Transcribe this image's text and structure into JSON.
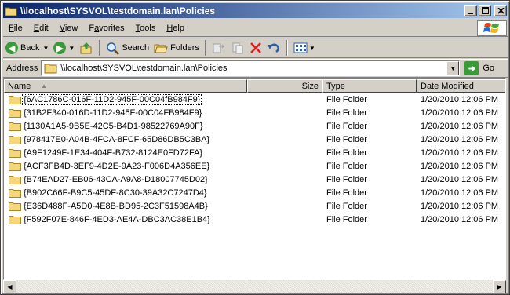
{
  "window": {
    "title": "\\\\localhost\\SYSVOL\\testdomain.lan\\Policies"
  },
  "menu": [
    {
      "label": "File",
      "ul": "F",
      "rest": "ile"
    },
    {
      "label": "Edit",
      "ul": "E",
      "rest": "dit"
    },
    {
      "label": "View",
      "ul": "V",
      "rest": "iew"
    },
    {
      "label": "Favorites",
      "ul": "F",
      "rest": "avorites",
      "pre": "F"
    },
    {
      "label": "Tools",
      "ul": "T",
      "rest": "ools"
    },
    {
      "label": "Help",
      "ul": "H",
      "rest": "elp"
    }
  ],
  "toolbar": {
    "back_label": "Back",
    "search_label": "Search",
    "folders_label": "Folders"
  },
  "address": {
    "label": "Address",
    "value": "\\\\localhost\\SYSVOL\\testdomain.lan\\Policies",
    "go_label": "Go"
  },
  "columns": {
    "name": "Name",
    "size": "Size",
    "type": "Type",
    "modified": "Date Modified"
  },
  "files": [
    {
      "name": "{6AC1786C-016F-11D2-945F-00C04fB984F9}",
      "size": "",
      "type": "File Folder",
      "modified": "1/20/2010 12:06 PM"
    },
    {
      "name": "{31B2F340-016D-11D2-945F-00C04FB984F9}",
      "size": "",
      "type": "File Folder",
      "modified": "1/20/2010 12:06 PM"
    },
    {
      "name": "{1130A1A5-9B5E-42C5-B4D1-98522769A90F}",
      "size": "",
      "type": "File Folder",
      "modified": "1/20/2010 12:06 PM"
    },
    {
      "name": "{978417E0-A04B-4FCA-8FCF-65D86DB5C3BA}",
      "size": "",
      "type": "File Folder",
      "modified": "1/20/2010 12:06 PM"
    },
    {
      "name": "{A9F1249F-1E34-404F-B732-8124E0FD72FA}",
      "size": "",
      "type": "File Folder",
      "modified": "1/20/2010 12:06 PM"
    },
    {
      "name": "{ACF3FB4D-3EF9-4D2E-9A23-F006D4A356EE}",
      "size": "",
      "type": "File Folder",
      "modified": "1/20/2010 12:06 PM"
    },
    {
      "name": "{B74EAD27-EB06-43CA-A9A8-D18007745D02}",
      "size": "",
      "type": "File Folder",
      "modified": "1/20/2010 12:06 PM"
    },
    {
      "name": "{B902C66F-B9C5-45DF-8C30-39A32C7247D4}",
      "size": "",
      "type": "File Folder",
      "modified": "1/20/2010 12:06 PM"
    },
    {
      "name": "{E36D488F-A5D0-4E8B-BD95-2C3F51598A4B}",
      "size": "",
      "type": "File Folder",
      "modified": "1/20/2010 12:06 PM"
    },
    {
      "name": "{F592F07E-846F-4ED3-AE4A-DBC3AC38E1B4}",
      "size": "",
      "type": "File Folder",
      "modified": "1/20/2010 12:06 PM"
    }
  ]
}
